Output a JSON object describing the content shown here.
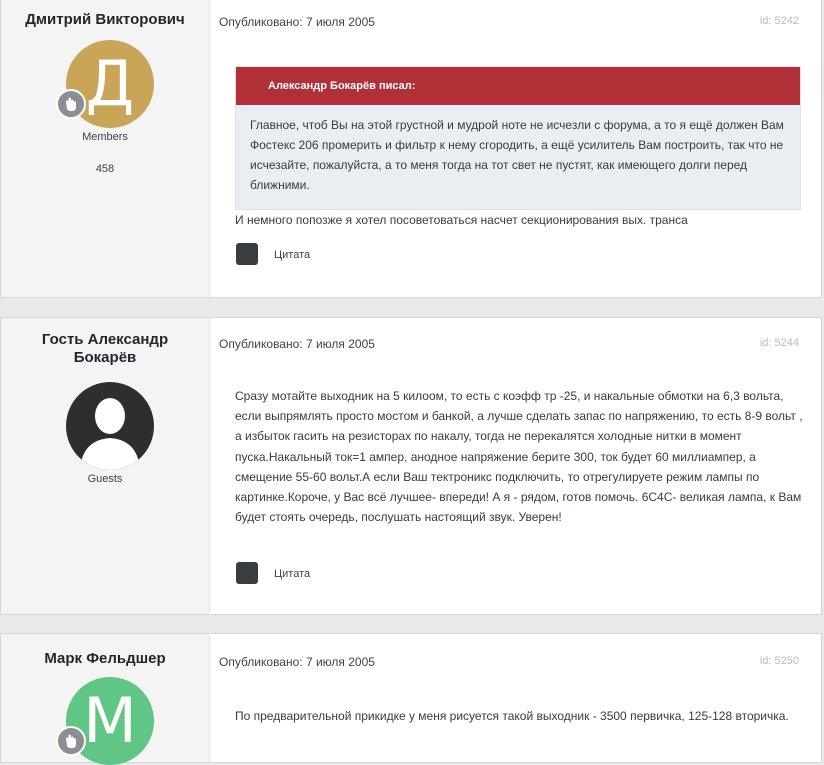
{
  "posts": [
    {
      "author": "Дмитрий Викторович",
      "avatar_letter": "Д",
      "avatar_color": "#c9a558",
      "group": "Members",
      "post_count": "458",
      "published": "Опубликовано: 7 июля 2005",
      "id_label": "id: 5242",
      "quote": {
        "author_line": "Александр Бокарёв писал:",
        "text": "Главное, чтоб Вы на этой грустной и мудрой ноте не исчезли с форума, а то я ещё должен Вам Фостекс 206 промерить и фильтр к нему сгородить, а ещё усилитель Вам построить, так что не исчезайте, пожалуйста, а то меня тогда на тот свет не пустят, как имеющего долги перед ближними."
      },
      "text": "И немного попозже я хотел посоветоваться насчет секционирования вых. транса",
      "quote_button": "Цитата"
    },
    {
      "author": "Гость Александр Бокарёв",
      "group": "Guests",
      "published": "Опубликовано: 7 июля 2005",
      "id_label": "id: 5244",
      "text": "Сразу мотайте выходник на 5 килоом, то есть с коэфф тр -25, и накальные обмотки на 6,3 вольта, если выпрямлять просто мостом и банкой, а лучше сделать запас по напряжению, то есть 8-9 вольт , а избыток гасить на резисторах по накалу, тогда не перекалятся холодные нитки в момент пуска.Накальный ток=1 ампер, анодное напряжение берите 300, ток будет 60 миллиампер, а смещение 55-60 вольт.А если Ваш тектроникс подключить, то отрегулируете режим лампы по картинке.Короче, у Вас всё лучшее- впереди! А я - рядом, готов помочь. 6С4С- великая лампа, к Вам будет стоять очередь, послушать настоящий звук. Уверен!",
      "quote_button": "Цитата"
    },
    {
      "author": "Марк Фельдшер",
      "avatar_letter": "М",
      "avatar_color": "#5fc685",
      "published": "Опубликовано: 7 июля 2005",
      "id_label": "id: 5250",
      "text": "По предварительной прикидке у меня рисуется такой выходник - 3500 первичка, 125-128 вторичка."
    }
  ]
}
